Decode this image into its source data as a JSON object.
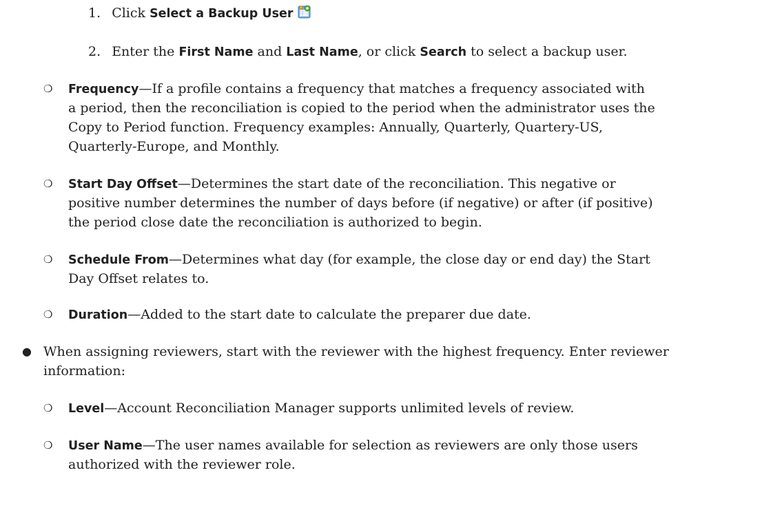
{
  "steps": [
    {
      "number": "1.",
      "text_before": "Click ",
      "term": "Select a Backup User",
      "icon": "select-backup-user-icon"
    },
    {
      "number": "2.",
      "text_before": "Enter the ",
      "term1": "First Name",
      "text_mid1": " and ",
      "term2": "Last Name",
      "text_mid2": ", or click ",
      "term3": "Search",
      "text_after": " to select a backup user."
    }
  ],
  "sub_items": [
    {
      "bullet": "❍",
      "term": "Frequency",
      "dash": "—",
      "lines": [
        "If a profile contains a frequency that matches a frequency associated with",
        "a period, then the reconciliation is copied to the period when the administrator uses the",
        "Copy to Period function. Frequency examples: Annually, Quarterly, Quartery-US,",
        "Quarterly-Europe, and Monthly."
      ]
    },
    {
      "bullet": "❍",
      "term": "Start Day Offset",
      "dash": "—",
      "lines": [
        "Determines the start date of the reconciliation. This negative or",
        "positive number determines the number of days before (if negative) or after (if positive)",
        "the period close date the reconciliation is authorized to begin."
      ]
    },
    {
      "bullet": "❍",
      "term": "Schedule From",
      "dash": "—",
      "lines": [
        "Determines what day (for example, the close day or end day) the Start",
        "Day Offset relates to."
      ]
    },
    {
      "bullet": "❍",
      "term": "Duration",
      "dash": "—",
      "lines": [
        "Added to the start date to calculate the preparer due date."
      ]
    }
  ],
  "main_bullet": {
    "bullet": "●",
    "lines": [
      "When assigning reviewers, start with the reviewer with the highest frequency. Enter reviewer",
      "information:"
    ]
  },
  "reviewer_items": [
    {
      "bullet": "❍",
      "term": "Level",
      "dash": "—",
      "lines": [
        "Account Reconciliation Manager supports unlimited levels of review."
      ]
    },
    {
      "bullet": "❍",
      "term": "User Name",
      "dash": "—",
      "lines": [
        "The user names available for selection as reviewers are only those users",
        "authorized with the reviewer role."
      ]
    }
  ]
}
